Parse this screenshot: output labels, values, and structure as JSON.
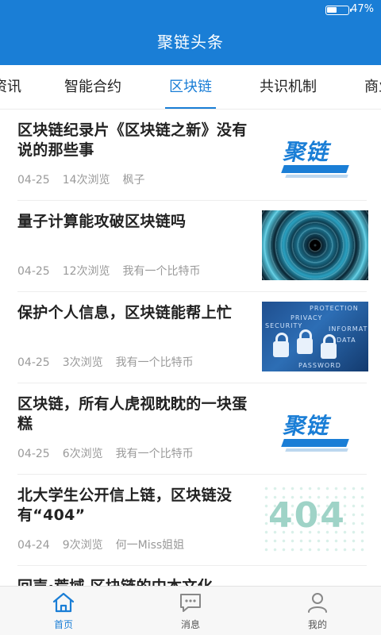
{
  "status_bar": {
    "battery_text": "47%",
    "battery_level": 0.47
  },
  "header": {
    "title": "聚链头条"
  },
  "tabs": [
    {
      "label": "资讯",
      "active": false
    },
    {
      "label": "智能合约",
      "active": false
    },
    {
      "label": "区块链",
      "active": true
    },
    {
      "label": "共识机制",
      "active": false
    },
    {
      "label": "商业",
      "active": false
    }
  ],
  "articles": [
    {
      "title": "区块链纪录片《区块链之新》没有说的那些事",
      "date": "04-25",
      "views": "14次浏览",
      "author": "枫子",
      "thumb": "brand",
      "thumb_text": "聚链"
    },
    {
      "title": "量子计算能攻破区块链吗",
      "date": "04-25",
      "views": "12次浏览",
      "author": "我有一个比特币",
      "thumb": "tunnel"
    },
    {
      "title": "保护个人信息，区块链能帮上忙",
      "date": "04-25",
      "views": "3次浏览",
      "author": "我有一个比特币",
      "thumb": "locks",
      "thumb_words": [
        "PROTECTION",
        "PRIVACY",
        "SECURITY",
        "INFORMATION",
        "DATA",
        "PASSWORD"
      ]
    },
    {
      "title": "区块链，所有人虎视眈眈的一块蛋糕",
      "date": "04-25",
      "views": "6次浏览",
      "author": "我有一个比特币",
      "thumb": "brand",
      "thumb_text": "聚链"
    },
    {
      "title": "北大学生公开信上链，区块链没有“404”",
      "date": "04-24",
      "views": "9次浏览",
      "author": "何一Miss姐姐",
      "thumb": "404",
      "thumb_text": "404"
    },
    {
      "title": "回声·荒域 区块链的中本文化",
      "date": "",
      "views": "",
      "author": "",
      "thumb": "none"
    }
  ],
  "bottom_nav": [
    {
      "label": "首页",
      "icon": "home-icon",
      "active": true
    },
    {
      "label": "消息",
      "icon": "message-icon",
      "active": false
    },
    {
      "label": "我的",
      "icon": "user-icon",
      "active": false
    }
  ],
  "colors": {
    "accent": "#1a7ed6",
    "meta_text": "#9a9a9a"
  }
}
